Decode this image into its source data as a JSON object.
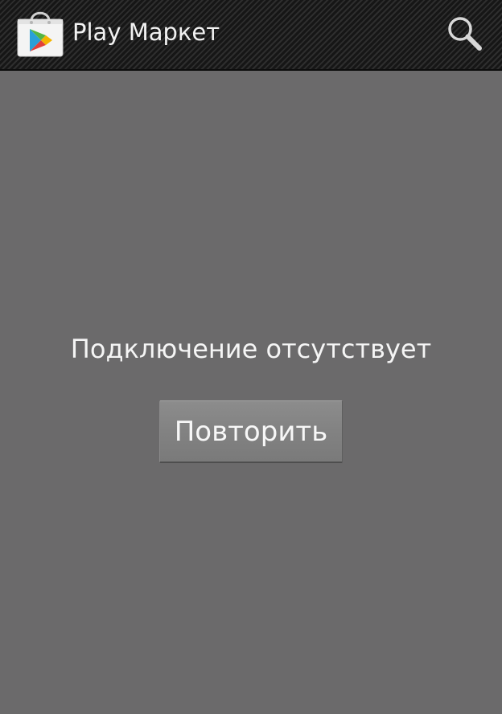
{
  "action_bar": {
    "app_icon": "play-store-bag-icon",
    "title": "Play Маркет",
    "search_icon": "search-icon"
  },
  "main": {
    "message": "Подключение отсутствует",
    "retry_label": "Повторить"
  },
  "colors": {
    "background": "#6b6a6b",
    "action_bar": "#1b1b1b",
    "button": "#838383",
    "text": "#f5f5f5"
  }
}
